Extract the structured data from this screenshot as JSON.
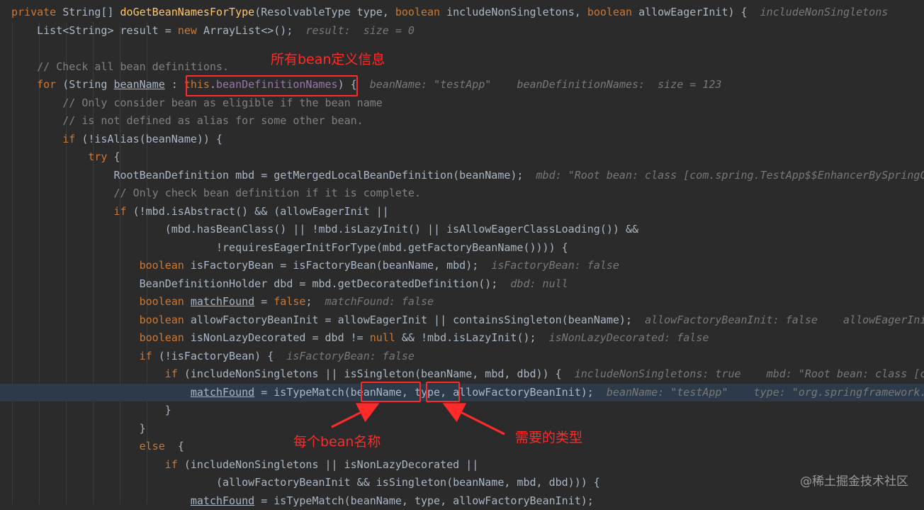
{
  "code_lines": [
    [
      [
        "kw",
        "private "
      ],
      [
        "plain",
        "String[] "
      ],
      [
        "fn",
        "doGetBeanNamesForType"
      ],
      [
        "plain",
        "(ResolvableType type, "
      ],
      [
        "kw",
        "boolean "
      ],
      [
        "plain",
        "includeNonSingletons, "
      ],
      [
        "kw",
        "boolean "
      ],
      [
        "plain",
        "allowEagerInit) {  "
      ],
      [
        "hint",
        "includeNonSingletons"
      ]
    ],
    [
      [
        "plain",
        "    List<String> result = "
      ],
      [
        "kw",
        "new "
      ],
      [
        "plain",
        "ArrayList<>();  "
      ],
      [
        "hint",
        "result:  size = 0"
      ]
    ],
    [],
    [
      [
        "com",
        "    // Check all bean definitions."
      ]
    ],
    [
      [
        "kw",
        "    for "
      ],
      [
        "plain",
        "(String "
      ],
      [
        "var",
        "beanName"
      ],
      [
        "plain",
        " : "
      ],
      [
        "kw",
        "this"
      ],
      [
        "plain",
        "."
      ],
      [
        "field",
        "beanDefinitionNames"
      ],
      [
        "plain",
        ") {  "
      ],
      [
        "hint",
        "beanName: \"testApp\"    beanDefinitionNames:  size = 123"
      ]
    ],
    [
      [
        "com",
        "        // Only consider bean as eligible if the bean name"
      ]
    ],
    [
      [
        "com",
        "        // is not defined as alias for some other bean."
      ]
    ],
    [
      [
        "kw",
        "        if "
      ],
      [
        "plain",
        "(!isAlias(beanName)) {"
      ]
    ],
    [
      [
        "kw",
        "            try "
      ],
      [
        "plain",
        "{"
      ]
    ],
    [
      [
        "plain",
        "                RootBeanDefinition mbd = getMergedLocalBeanDefinition(beanName);  "
      ],
      [
        "hint",
        "mbd: \"Root bean: class [com.spring.TestApp$$EnhancerBySpringCGLIB"
      ]
    ],
    [
      [
        "com",
        "                // Only check bean definition if it is complete."
      ]
    ],
    [
      [
        "kw",
        "                if "
      ],
      [
        "plain",
        "(!mbd.isAbstract() && (allowEagerInit ||"
      ]
    ],
    [
      [
        "plain",
        "                        (mbd.hasBeanClass() || !mbd.isLazyInit() || isAllowEagerClassLoading()) &&"
      ]
    ],
    [
      [
        "plain",
        "                                !requiresEagerInitForType(mbd.getFactoryBeanName()))) {"
      ]
    ],
    [
      [
        "kw",
        "                    boolean "
      ],
      [
        "plain",
        "isFactoryBean = isFactoryBean(beanName, mbd);  "
      ],
      [
        "hint",
        "isFactoryBean: false"
      ]
    ],
    [
      [
        "plain",
        "                    BeanDefinitionHolder dbd = mbd.getDecoratedDefinition();  "
      ],
      [
        "hint",
        "dbd: null"
      ]
    ],
    [
      [
        "kw",
        "                    boolean "
      ],
      [
        "var",
        "matchFound"
      ],
      [
        "plain",
        " = "
      ],
      [
        "kw",
        "false"
      ],
      [
        "plain",
        ";  "
      ],
      [
        "hint",
        "matchFound: false"
      ]
    ],
    [
      [
        "kw",
        "                    boolean "
      ],
      [
        "plain",
        "allowFactoryBeanInit = allowEagerInit || containsSingleton(beanName);  "
      ],
      [
        "hint",
        "allowFactoryBeanInit: false    allowEagerInit: false"
      ]
    ],
    [
      [
        "kw",
        "                    boolean "
      ],
      [
        "plain",
        "isNonLazyDecorated = dbd != "
      ],
      [
        "kw",
        "null "
      ],
      [
        "plain",
        "&& !mbd.isLazyInit();  "
      ],
      [
        "hint",
        "isNonLazyDecorated: false"
      ]
    ],
    [
      [
        "kw",
        "                    if "
      ],
      [
        "plain",
        "(!isFactoryBean) {  "
      ],
      [
        "hint",
        "isFactoryBean: false"
      ]
    ],
    [
      [
        "kw",
        "                        if "
      ],
      [
        "plain",
        "(includeNonSingletons || isSingleton(beanName, mbd, dbd)) {  "
      ],
      [
        "hint",
        "includeNonSingletons: true    mbd: \"Root bean: class [com"
      ]
    ],
    [
      [
        "plain",
        "                            "
      ],
      [
        "var",
        "matchFound"
      ],
      [
        "plain",
        " = isTypeMatch(beanName, type, allowFactoryBeanInit);  "
      ],
      [
        "hint",
        "beanName: \"testApp\"    type: \"org.springframework.core"
      ]
    ],
    [
      [
        "plain",
        "                        }"
      ]
    ],
    [
      [
        "plain",
        "                    }"
      ]
    ],
    [
      [
        "kw",
        "                    else  "
      ],
      [
        "plain",
        "{"
      ]
    ],
    [
      [
        "kw",
        "                        if "
      ],
      [
        "plain",
        "(includeNonSingletons || isNonLazyDecorated ||"
      ]
    ],
    [
      [
        "plain",
        "                                (allowFactoryBeanInit && isSingleton(beanName, mbd, dbd))) {"
      ]
    ],
    [
      [
        "plain",
        "                            "
      ],
      [
        "var",
        "matchFound"
      ],
      [
        "plain",
        " = isTypeMatch(beanName, type, allowFactoryBeanInit);"
      ]
    ]
  ],
  "highlight_line_index": 21,
  "annotations": {
    "all_bean_defs": "所有bean定义信息",
    "each_bean_name": "每个bean名称",
    "required_type": "需要的类型"
  },
  "watermark": "@稀土掘金技术社区"
}
